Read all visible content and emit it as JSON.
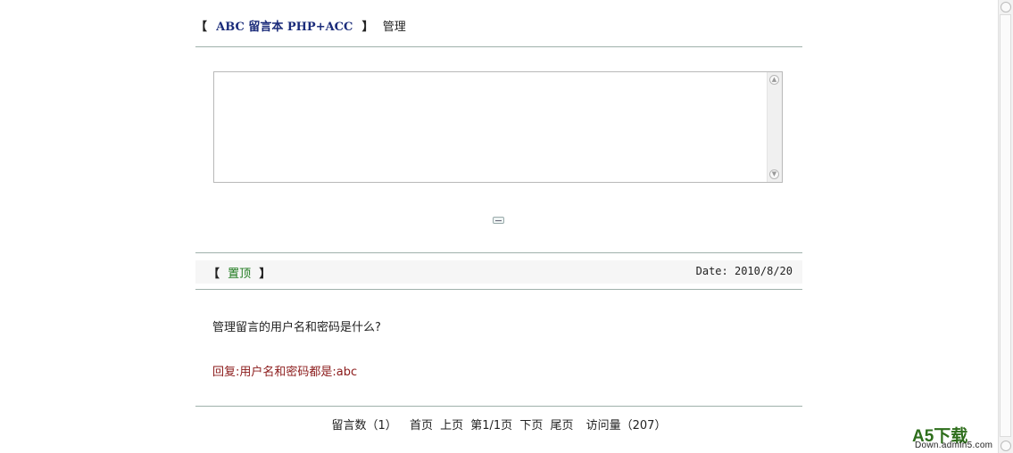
{
  "header": {
    "bracket_open": "【",
    "title": "ABC 留言本 PHP+ACC",
    "bracket_close": "】",
    "manage": "管理"
  },
  "post": {
    "bracket_open": "【",
    "tag": "置顶",
    "bracket_close": "】",
    "date": "Date: 2010/8/20",
    "question": "管理留言的用户名和密码是什么?",
    "reply": "回复:用户名和密码都是:abc"
  },
  "footer": {
    "count_label": "留言数（1）",
    "first": "首页",
    "prev": "上页",
    "page_info": "第1/1页",
    "next": "下页",
    "last": "尾页",
    "visits": "访问量（207）"
  },
  "watermark": {
    "brand": "A5下载",
    "url": "Down.admin5.com"
  },
  "colors": {
    "title": "#1a2b7a",
    "pin": "#1e7a1e",
    "reply": "#8b1a1a",
    "divider": "#9fb1ab"
  }
}
